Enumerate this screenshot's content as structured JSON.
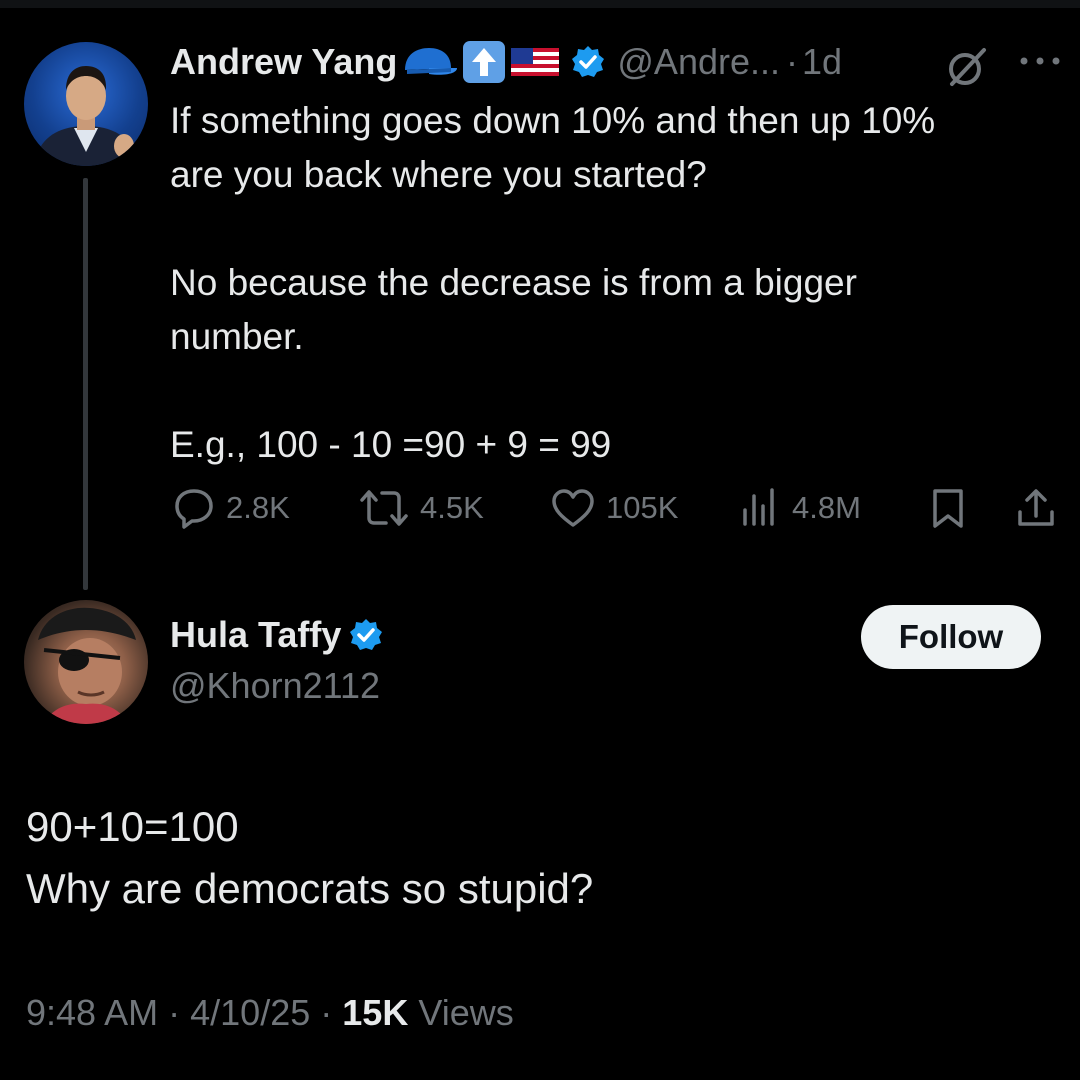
{
  "parent_tweet": {
    "author": {
      "display_name": "Andrew Yang",
      "handle": "@Andre...",
      "verified": true,
      "name_emojis": [
        "blue-cap-icon",
        "up-arrow-icon",
        "us-flag-icon"
      ]
    },
    "age_separator": "·",
    "age": "1d",
    "text": {
      "line1": "If something goes down 10% and then up 10%",
      "line2": "are you back where you started?",
      "para2_line1": "No because the decrease is from a bigger",
      "para2_line2": "number.",
      "para3": "E.g., 100 - 10 =90 + 9 = 99"
    },
    "stats": {
      "replies": "2.8K",
      "reposts": "4.5K",
      "likes": "105K",
      "views": "4.8M"
    }
  },
  "reply": {
    "author": {
      "display_name": "Hula Taffy",
      "handle": "@Khorn2112",
      "verified": true
    },
    "follow_label": "Follow",
    "text": {
      "line1": "90+10=100",
      "line2": "Why are democrats so stupid?"
    },
    "time": "9:48 AM",
    "separator": "·",
    "date": "4/10/25",
    "views_count": "15K",
    "views_label": "Views"
  },
  "colors": {
    "background": "#000000",
    "text_primary": "#e7e9ea",
    "text_secondary": "#71767b",
    "verified_blue": "#1d9bf0",
    "follow_button_bg": "#eff3f4"
  }
}
